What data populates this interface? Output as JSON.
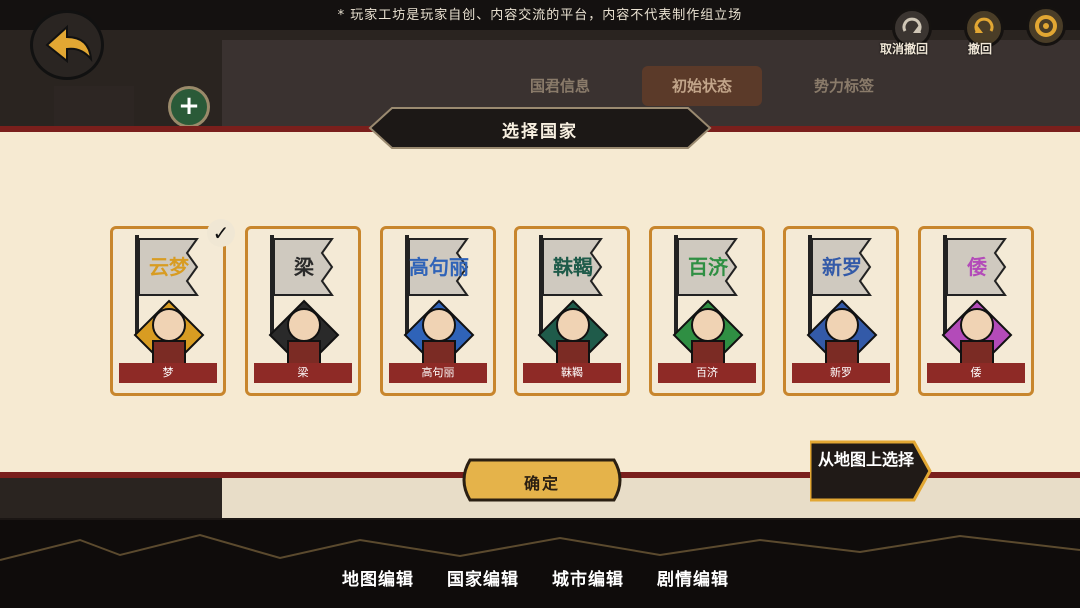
{
  "notice": "* 玩家工坊是玩家自创、内容交流的平台，内容不代表制作组立场",
  "top_buttons": {
    "cancel_undo": "取消撤回",
    "undo": "撤回"
  },
  "tabs": [
    {
      "label": "国君信息",
      "active": false
    },
    {
      "label": "初始状态",
      "active": true
    },
    {
      "label": "势力标签",
      "active": false
    }
  ],
  "dialog": {
    "title": "选择国家",
    "confirm": "确定",
    "select_from_map": "从地图上选择"
  },
  "countries": [
    {
      "flag": "云梦",
      "name": "梦",
      "selected": true,
      "flag_color": "#d89c22"
    },
    {
      "flag": "梁",
      "name": "梁",
      "selected": false,
      "flag_color": "#2a2a2a"
    },
    {
      "flag": "高句丽",
      "name": "高句丽",
      "selected": false,
      "flag_color": "#2f63b8"
    },
    {
      "flag": "靺鞨",
      "name": "靺鞨",
      "selected": false,
      "flag_color": "#1f5b4a"
    },
    {
      "flag": "百济",
      "name": "百济",
      "selected": false,
      "flag_color": "#2f8f43"
    },
    {
      "flag": "新罗",
      "name": "新罗",
      "selected": false,
      "flag_color": "#335aa8"
    },
    {
      "flag": "倭",
      "name": "倭",
      "selected": false,
      "flag_color": "#b34bb9"
    }
  ],
  "bottom_tabs": [
    "地图编辑",
    "国家编辑",
    "城市编辑",
    "剧情编辑"
  ],
  "colors": {
    "accent_red": "#8e2a26",
    "card_border": "#c8862d",
    "panel_bg": "#f6ead2"
  }
}
